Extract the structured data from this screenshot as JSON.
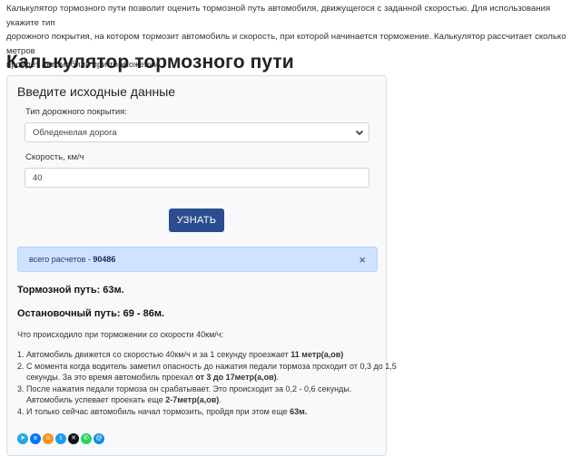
{
  "intro": {
    "line1": "Калькулятор тормозного пути позволит оценить тормозной путь автомобиля, движущегося с заданной скоростью. Для использования укажите тип",
    "line2": "дорожного покрытия, на котором тормозит автомобиль и скорость, при которой начинается торможение. Калькулятор рассчитает сколько метров",
    "line3": "пройдет автомобиль при торможении."
  },
  "page_title": "Калькулятор тормозного пути",
  "form": {
    "title": "Введите исходные данные",
    "road_label": "Тип дорожного покрытия:",
    "road_value": "Обледенелая дорога",
    "speed_label": "Скорость, км/ч",
    "speed_value": "40",
    "submit_label": "УЗНАТЬ"
  },
  "alert": {
    "prefix": "всего расчетов - ",
    "count": "90486",
    "close": "×"
  },
  "results": {
    "braking": "Тормозной путь: 63м.",
    "stopping": "Остановочный путь: 69 - 86м.",
    "intro": "Что происходило при торможении со скорости 40км/ч:",
    "s1_a": "Автомобиль движется со скоростью 40км/ч и за 1 секунду проезжает ",
    "s1_b": "11 метр(а,ов)",
    "s2_a": "С момента когда водитель заметил опасность до нажатия педали тормоза проходит от 0,3 до 1,5 секунды. За это время автомобиль проехал ",
    "s2_b": "от 3 до 17метр(а,ов)",
    "s2_c": ".",
    "s3_a": "После нажатия педали тормоза он срабатывает. Это происходит за 0,2 - 0,6 секунды. Автомобиль успевает проехать еще ",
    "s3_b": "2-7метр(а,ов)",
    "s3_c": ".",
    "s4_a": "И только сейчас автомобиль начал тормозить, пройдя при этом еще ",
    "s4_b": "63м."
  },
  "share": {
    "colors": {
      "telegram": "#27a6e5",
      "vk": "#0077ff",
      "ok": "#f7931e",
      "twitter": "#1d9bf0",
      "x": "#111111",
      "whatsapp": "#25d366",
      "mymail": "#168de2"
    }
  }
}
